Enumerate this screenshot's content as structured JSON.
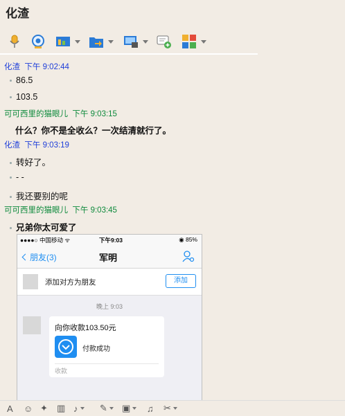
{
  "window": {
    "title": "化渣"
  },
  "toolbar": {
    "items": [
      {
        "name": "mic-icon",
        "has_dropdown": false
      },
      {
        "name": "video-icon",
        "has_dropdown": false
      },
      {
        "name": "screen-share-icon",
        "has_dropdown": true
      },
      {
        "name": "file-transfer-icon",
        "has_dropdown": true
      },
      {
        "name": "remote-desktop-icon",
        "has_dropdown": true
      },
      {
        "name": "group-chat-icon",
        "has_dropdown": false
      },
      {
        "name": "apps-icon",
        "has_dropdown": true
      }
    ]
  },
  "messages": [
    {
      "sender": "化渣",
      "time": "下午 9:02:44",
      "side": "me",
      "lines": [
        "86.5",
        "103.5"
      ]
    },
    {
      "sender": "可可西里的猫眼儿",
      "time": "下午 9:03:15",
      "side": "other",
      "lines": [
        "什么？你不是全收么？一次结清就行了。"
      ]
    },
    {
      "sender": "化渣",
      "time": "下午 9:03:19",
      "side": "me",
      "lines": [
        "转好了。",
        "- -",
        "我还要别的呢"
      ]
    },
    {
      "sender": "可可西里的猫眼儿",
      "time": "下午 9:03:45",
      "side": "other",
      "lines": [
        "兄弟你太可爱了"
      ]
    }
  ],
  "phone_screenshot": {
    "status_left": "●●●●○ 中国移动 ᯤ",
    "status_time": "下午9:03",
    "status_battery": "◉ 85%",
    "back_label": "朋友(3)",
    "title": "军明",
    "add_friend_text": "添加对方为朋友",
    "add_button": "添加",
    "timestamp": "晚上 9:03",
    "payment_amount": "向你收款103.50元",
    "payment_status": "付款成功",
    "footer": "收款"
  },
  "colors": {
    "background": "#f2ece4",
    "my_name": "#1f3fd9",
    "other_name": "#0e8a3c",
    "accent": "#1f8ef1"
  }
}
